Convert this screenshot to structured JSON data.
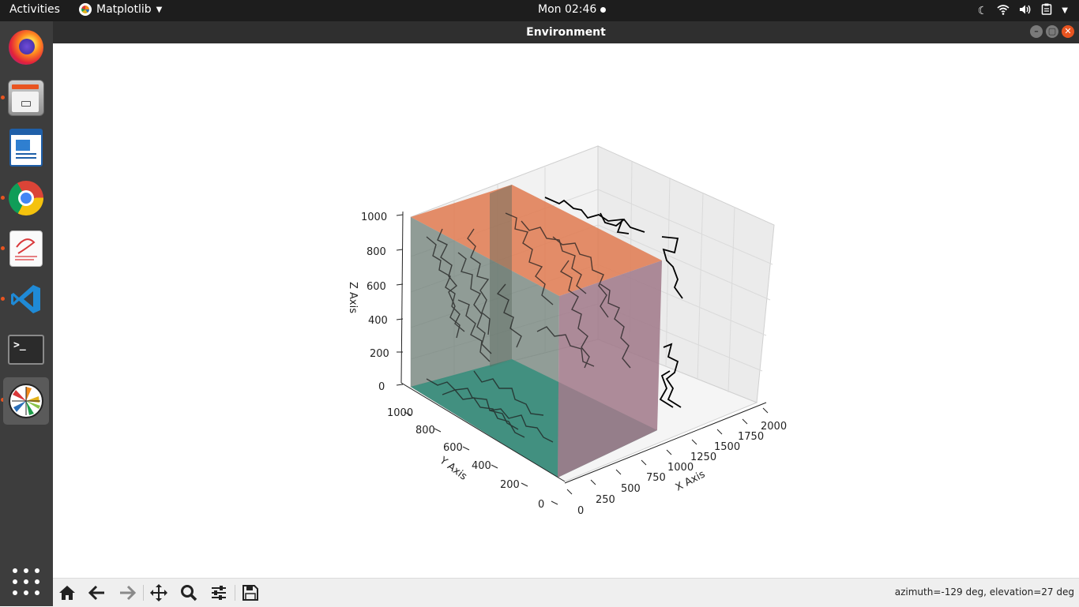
{
  "topbar": {
    "activities": "Activities",
    "app_name": "Matplotlib",
    "clock": "Mon 02:46",
    "tray_icons": [
      "moon-icon",
      "wifi-icon",
      "volume-icon",
      "clipboard-icon",
      "chevron-down-icon"
    ]
  },
  "dock": {
    "items": [
      {
        "name": "firefox",
        "running": false
      },
      {
        "name": "files",
        "running": true
      },
      {
        "name": "libreoffice-writer",
        "running": false
      },
      {
        "name": "chrome",
        "running": true
      },
      {
        "name": "document-viewer",
        "running": true
      },
      {
        "name": "vscode",
        "running": true
      },
      {
        "name": "terminal",
        "running": false
      },
      {
        "name": "matplotlib",
        "running": true,
        "active": true
      }
    ],
    "show_apps_icon": "grid-icon"
  },
  "window": {
    "title": "Environment"
  },
  "plot": {
    "x_label": "X Axis",
    "y_label": "Y Axis",
    "z_label": "Z Axis",
    "x_ticks": [
      "0",
      "250",
      "500",
      "750",
      "1000",
      "1250",
      "1500",
      "1750",
      "2000"
    ],
    "y_ticks": [
      "0",
      "200",
      "400",
      "600",
      "800",
      "1000"
    ],
    "z_ticks": [
      "0",
      "200",
      "400",
      "600",
      "800",
      "1000"
    ]
  },
  "toolbar": {
    "buttons": [
      "home-icon",
      "back-icon",
      "forward-icon",
      "pan-icon",
      "zoom-icon",
      "configure-icon",
      "save-icon"
    ],
    "status": "azimuth=-129 deg, elevation=27 deg"
  },
  "colors": {
    "topbar_bg": "#1d1d1d",
    "dock_bg": "#3d3d3d",
    "titlebar_bg": "#2f2f2f",
    "accent": "#e95420",
    "box_top": "#e07a50",
    "box_side_left": "#7a8a82",
    "box_bottom": "#2e8d7a",
    "box_side_right": "#a07888"
  }
}
